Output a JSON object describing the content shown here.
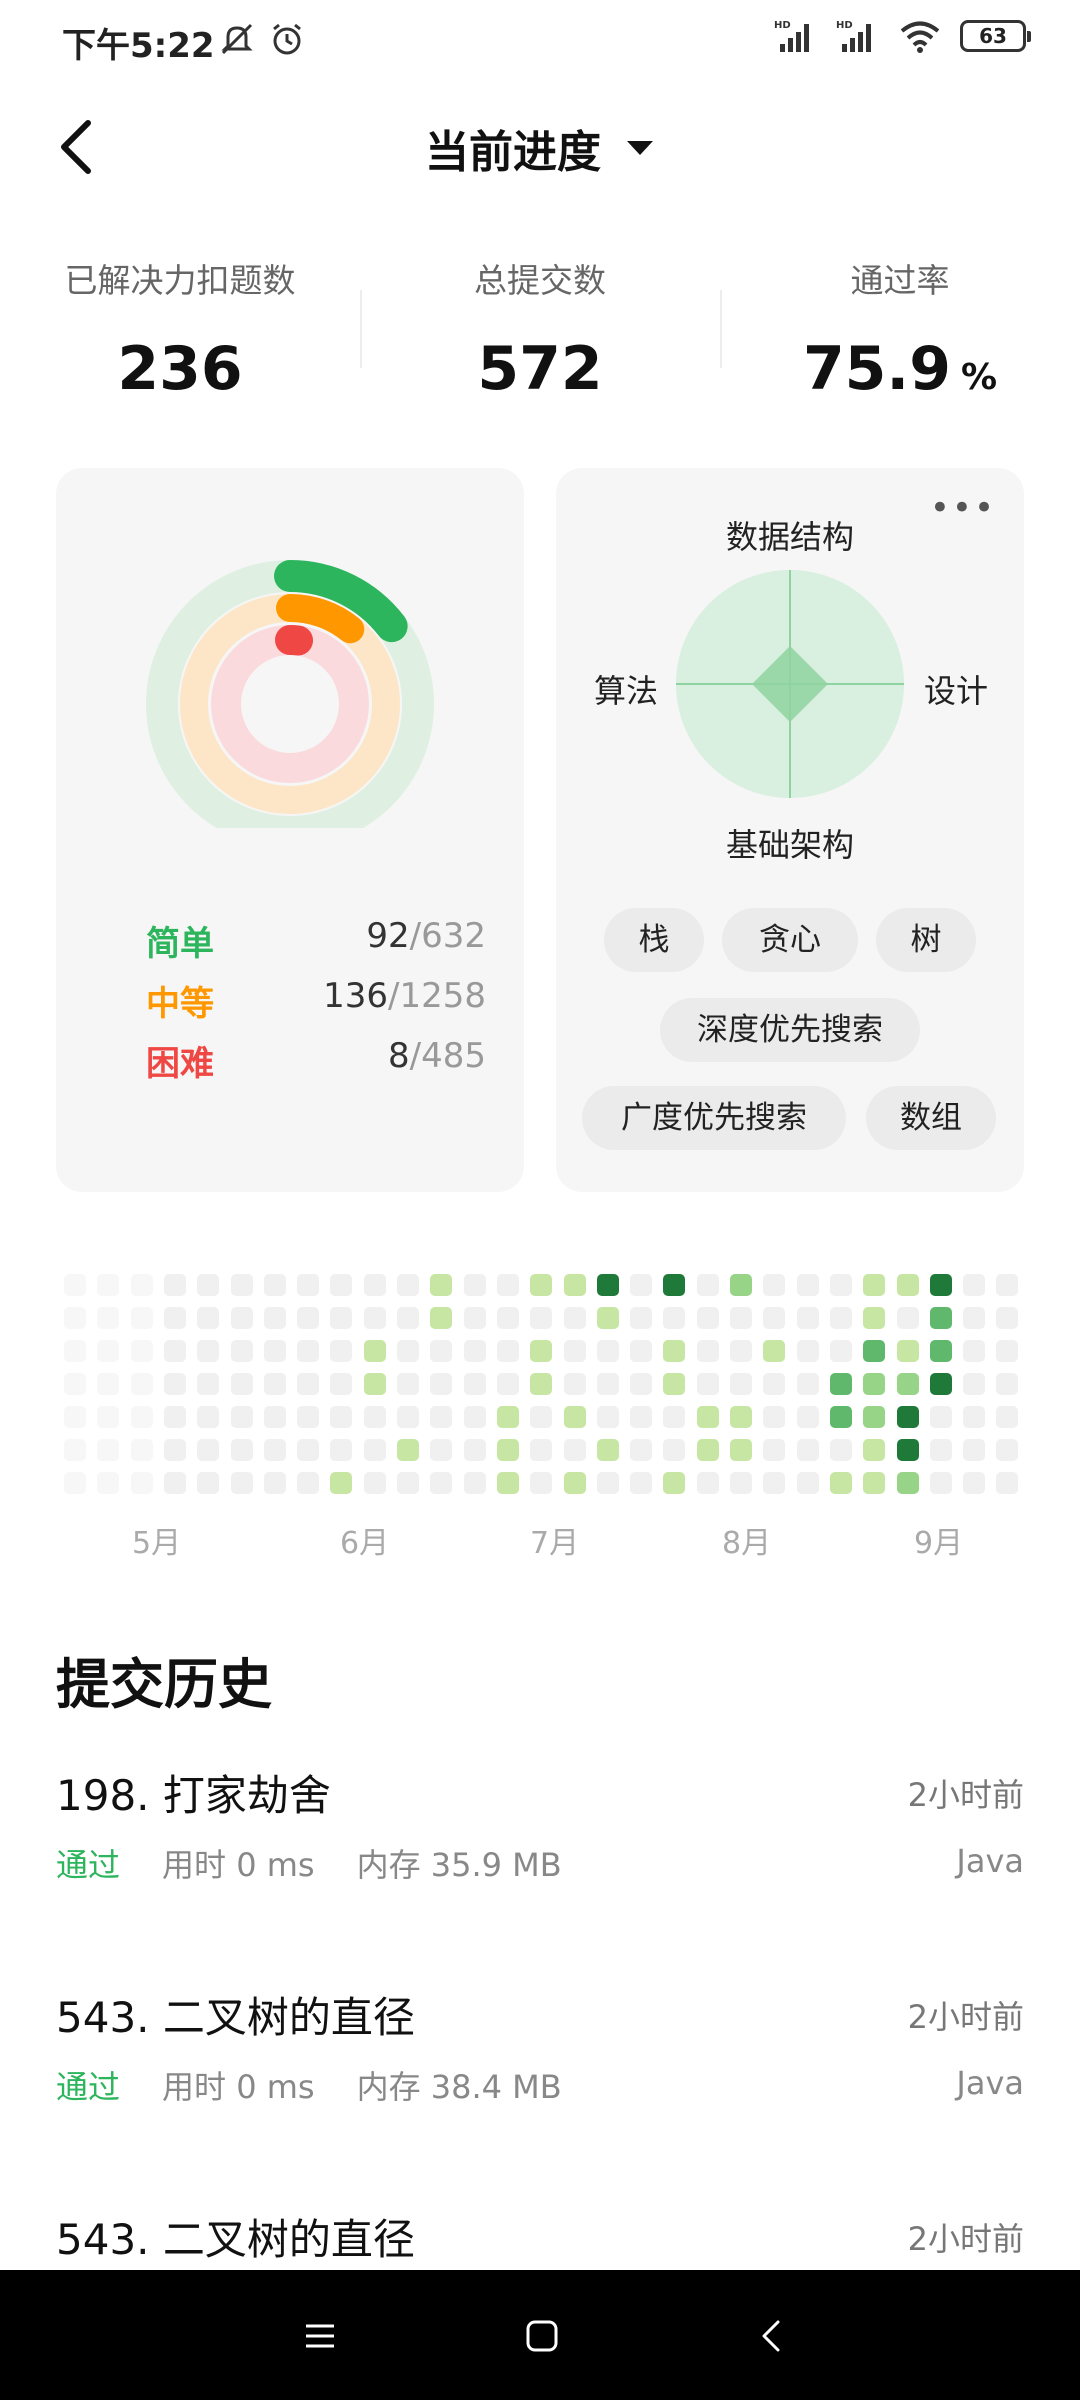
{
  "status_bar": {
    "time": "下午5:22",
    "battery": "63",
    "icons": [
      "mute-icon",
      "alarm-icon",
      "signal-hd-icon",
      "signal-hd-icon",
      "wifi-icon",
      "battery-icon"
    ]
  },
  "header": {
    "title": "当前进度"
  },
  "stats": [
    {
      "label": "已解决力扣题数",
      "value": "236",
      "unit": ""
    },
    {
      "label": "总提交数",
      "value": "572",
      "unit": ""
    },
    {
      "label": "通过率",
      "value": "75.9",
      "unit": "%"
    }
  ],
  "difficulty": {
    "items": [
      {
        "name": "简单",
        "solved": "92",
        "total": "/632",
        "color": "#2db55d",
        "fraction": 0.146
      },
      {
        "name": "中等",
        "solved": "136",
        "total": "/1258",
        "color": "#ff9800",
        "fraction": 0.108
      },
      {
        "name": "困难",
        "solved": "8",
        "total": "/485",
        "color": "#ef4743",
        "fraction": 0.016
      }
    ]
  },
  "skills": {
    "axes": {
      "top": "数据结构",
      "left": "算法",
      "right": "设计",
      "bottom": "基础架构"
    },
    "tags": [
      "栈",
      "贪心",
      "树",
      "深度优先搜索",
      "广度优先搜索",
      "数组"
    ],
    "colors": {
      "accent": "#2db55d",
      "radar_bg": "#d9efdf"
    }
  },
  "heatmap": {
    "months": [
      "5月",
      "6月",
      "7月",
      "8月",
      "9月"
    ],
    "colors": {
      "empty": "#f0f0f0",
      "l1": "#c7e6a3",
      "l2": "#98d487",
      "l3": "#5fb86b",
      "l4": "#1f7a3a"
    }
  },
  "history": {
    "title": "提交历史",
    "items": [
      {
        "title": "198. 打家劫舍",
        "time": "2小时前",
        "status": "通过",
        "runtime": "用时 0 ms",
        "memory": "内存 35.9 MB",
        "lang": "Java"
      },
      {
        "title": "543. 二叉树的直径",
        "time": "2小时前",
        "status": "通过",
        "runtime": "用时 0 ms",
        "memory": "内存 38.4 MB",
        "lang": "Java"
      },
      {
        "title": "543. 二叉树的直径",
        "time": "2小时前",
        "status": "",
        "runtime": "",
        "memory": "",
        "lang": ""
      }
    ]
  }
}
